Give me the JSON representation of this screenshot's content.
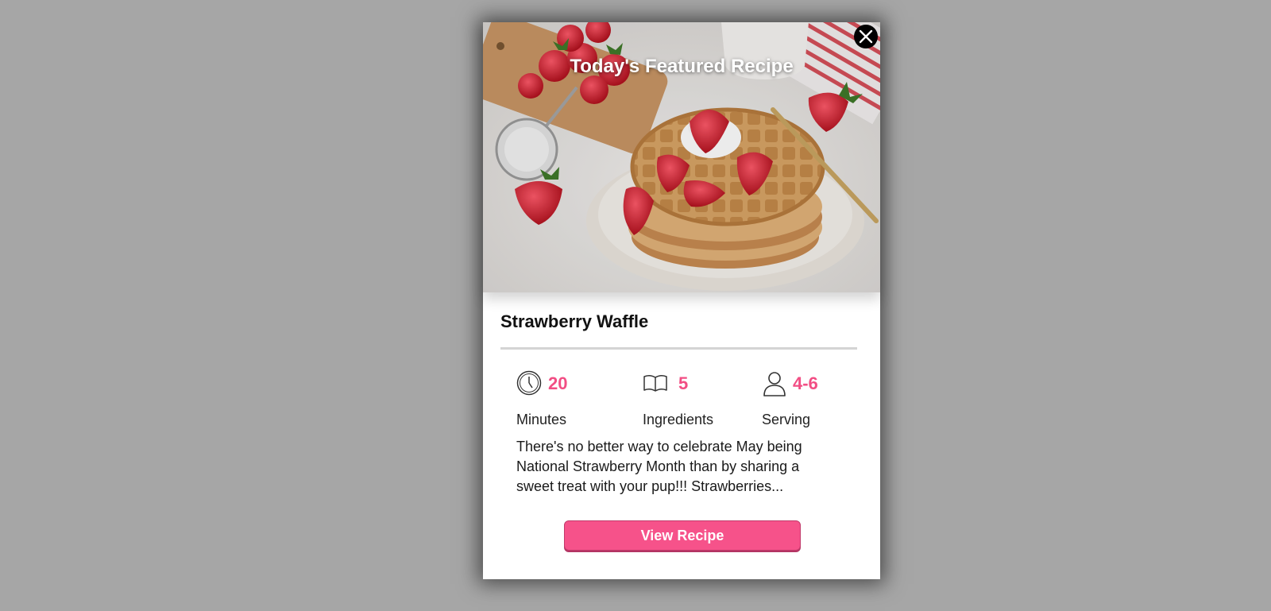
{
  "modal": {
    "hero_title": "Today's Featured Recipe",
    "close_icon": "close-icon",
    "recipe_name": "Strawberry Waffle",
    "stats": [
      {
        "icon": "clock-icon",
        "value": "20",
        "label": "Minutes"
      },
      {
        "icon": "book-icon",
        "value": "5",
        "label": "Ingredients"
      },
      {
        "icon": "person-icon",
        "value": "4-6",
        "label": "Serving"
      }
    ],
    "description": "There's no better way to celebrate May being National Strawberry Month than by sharing a sweet treat with your pup!!! Strawberries...",
    "button_label": "View Recipe"
  },
  "colors": {
    "backdrop": "#a6a6a6",
    "accent": "#f24e84",
    "button": "#f6528a"
  }
}
